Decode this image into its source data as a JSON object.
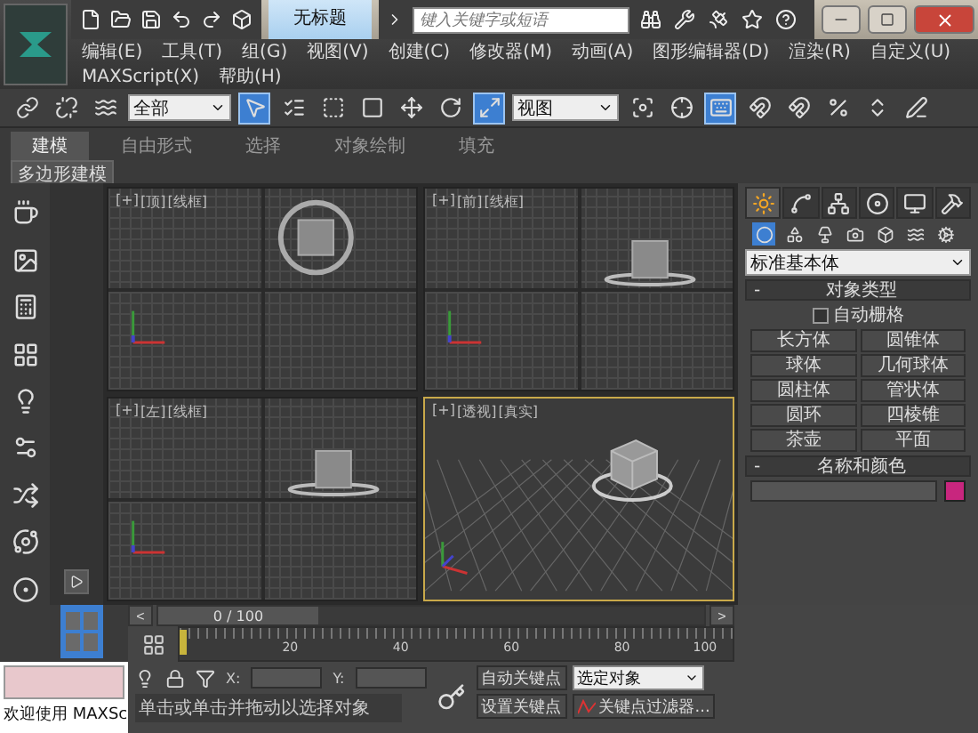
{
  "title_bar": {
    "document_title": "无标题",
    "search": {
      "placeholder": "键入关键字或短语"
    }
  },
  "menu_rows": [
    [
      "编辑(E)",
      "工具(T)",
      "组(G)",
      "视图(V)",
      "创建(C)",
      "修改器(M)",
      "动画(A)",
      "图形编辑器(D)",
      "渲染(R)",
      "自定义(U)"
    ],
    [
      "MAXScript(X)",
      "帮助(H)"
    ]
  ],
  "toolbar": {
    "selection_filter": "全部",
    "reference_coordinate": "视图",
    "tools": [
      {
        "kind": "link",
        "selected": false
      },
      {
        "kind": "unlink",
        "selected": false
      },
      {
        "kind": "bind",
        "selected": false
      },
      {
        "kind": "filter"
      },
      {
        "kind": "select",
        "selected": true
      },
      {
        "kind": "select_by_name",
        "selected": false
      },
      {
        "kind": "region",
        "selected": false
      },
      {
        "kind": "window",
        "selected": false
      },
      {
        "kind": "move",
        "selected": false
      },
      {
        "kind": "rotate",
        "selected": false
      },
      {
        "kind": "scale",
        "selected": true
      },
      {
        "kind": "coordinate"
      },
      {
        "kind": "pivot",
        "selected": false
      },
      {
        "kind": "manipulate",
        "selected": false
      },
      {
        "kind": "keyboard",
        "selected": true
      },
      {
        "kind": "snap",
        "selected": false
      },
      {
        "kind": "angle_snap",
        "selected": false
      },
      {
        "kind": "percent_snap",
        "selected": false
      },
      {
        "kind": "spinner_snap",
        "selected": false
      },
      {
        "kind": "named_sets",
        "selected": false
      }
    ]
  },
  "ribbon": {
    "tabs": [
      {
        "label": "建模",
        "selected": true
      },
      {
        "label": "自由形式",
        "selected": false
      },
      {
        "label": "选择",
        "selected": false
      },
      {
        "label": "对象绘制",
        "selected": false
      },
      {
        "label": "填充",
        "selected": false
      }
    ],
    "panel": "多边形建模"
  },
  "viewports": [
    {
      "kind": "top",
      "labels": [
        "[+]",
        "[顶]",
        "[线框]"
      ],
      "active": false
    },
    {
      "kind": "front",
      "labels": [
        "[+]",
        "[前]",
        "[线框]"
      ],
      "active": false
    },
    {
      "kind": "left",
      "labels": [
        "[+]",
        "[左]",
        "[线框]"
      ],
      "active": false
    },
    {
      "kind": "perspective",
      "labels": [
        "[+]",
        "[透视]",
        "[真实]"
      ],
      "active": true
    }
  ],
  "command_panel": {
    "tabs": [
      {
        "kind": "create",
        "selected": true
      },
      {
        "kind": "modify",
        "selected": false
      },
      {
        "kind": "hierarchy",
        "selected": false
      },
      {
        "kind": "motion",
        "selected": false
      },
      {
        "kind": "display",
        "selected": false
      },
      {
        "kind": "utilities",
        "selected": false
      }
    ],
    "categories": [
      {
        "kind": "geometry",
        "selected": true
      },
      {
        "kind": "shapes",
        "selected": false
      },
      {
        "kind": "lights",
        "selected": false
      },
      {
        "kind": "cameras",
        "selected": false
      },
      {
        "kind": "helpers",
        "selected": false
      },
      {
        "kind": "space_warps",
        "selected": false
      },
      {
        "kind": "systems",
        "selected": false
      }
    ],
    "dropdown": "标准基本体",
    "object_type": {
      "title": "对象类型",
      "collapse": "-",
      "autogrid": {
        "label": "自动栅格",
        "checked": false
      },
      "buttons": [
        "长方体",
        "圆锥体",
        "球体",
        "几何球体",
        "圆柱体",
        "管状体",
        "圆环",
        "四棱锥",
        "茶壶",
        "平面"
      ]
    },
    "name_and_color": {
      "title": "名称和颜色",
      "collapse": "-",
      "color": "#c8267e"
    }
  },
  "time_slider": {
    "prev": "<",
    "next": ">",
    "position": "0 / 100",
    "level": 0
  },
  "track_bar": {
    "ticks": [
      "20",
      "40",
      "60",
      "80",
      "100"
    ]
  },
  "status": {
    "listener_text": "欢迎使用 MAXSc",
    "x_label": "X:",
    "y_label": "Y:",
    "prompt": "单击或单击并拖动以选择对象",
    "auto_key": "自动关键点",
    "set_key": "设置关键点",
    "key_dropdown": "选定对象",
    "key_filters": "关键点过滤器..."
  }
}
